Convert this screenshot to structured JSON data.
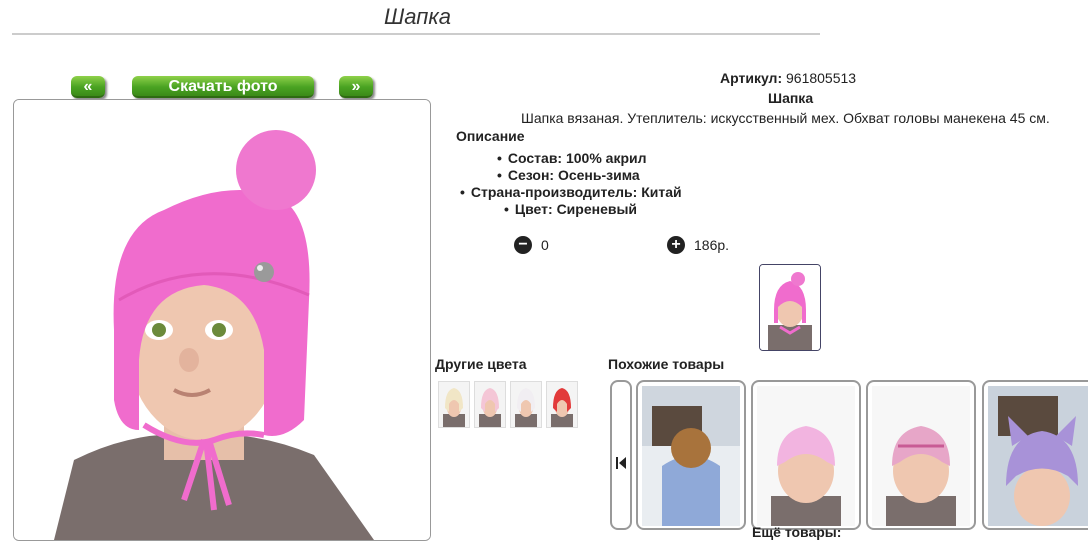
{
  "page": {
    "title": "Шапка"
  },
  "buttons": {
    "prev": "«",
    "download": "Скачать фото",
    "next": "»"
  },
  "product": {
    "article_label": "Артикул:",
    "article_value": "961805513",
    "name": "Шапка",
    "summary": "Шапка вязаная. Утеплитель: искусственный мех. Обхват головы манекена 45 см.",
    "description_heading": "Описание",
    "specs": [
      "Состав: 100% акрил",
      "Сезон: Осень-зима",
      "Страна-производитель: Китай",
      "Цвет: Сиреневый"
    ],
    "quantity": "0",
    "price": "186р."
  },
  "icons": {
    "minus": "minus-circle-icon",
    "plus": "plus-circle-icon",
    "first": "skip-first-icon"
  },
  "sections": {
    "other_colors": "Другие цвета",
    "similar": "Похожие товары",
    "more": "Ещё товары:"
  },
  "colors": {
    "accent_green": "#4aa322",
    "hat_pink": "#f06ccd"
  }
}
